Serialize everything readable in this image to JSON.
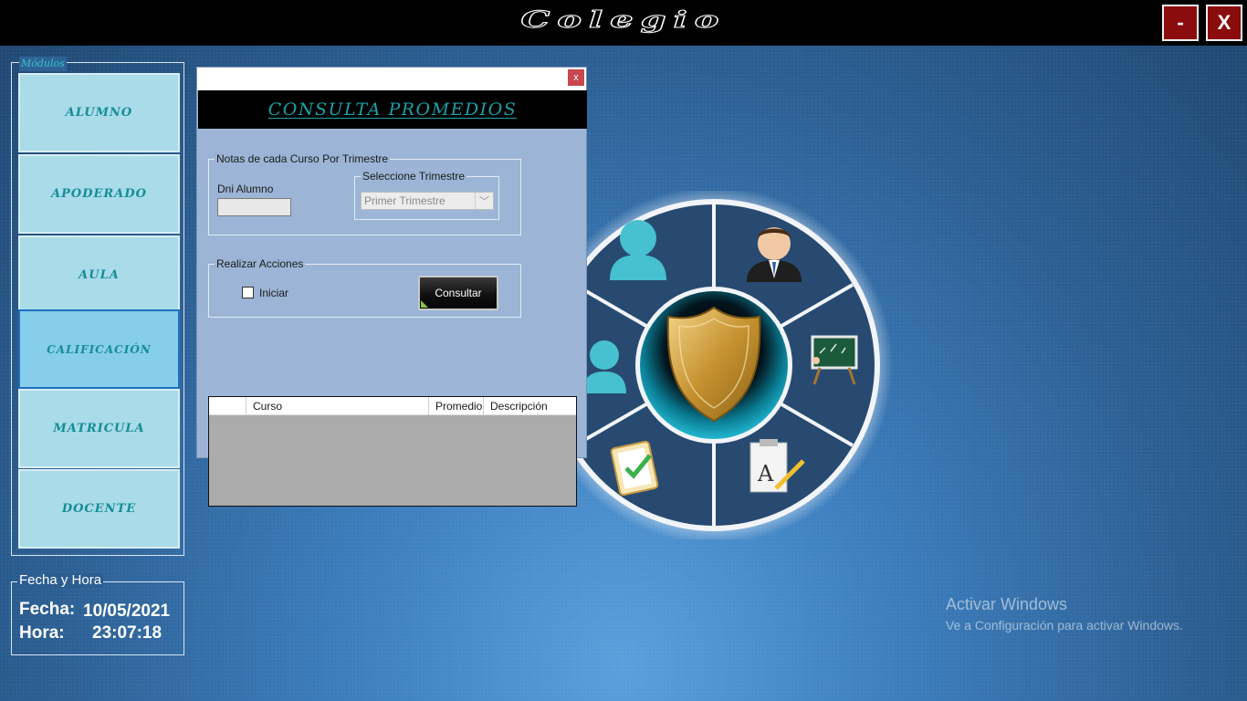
{
  "app": {
    "title": "Colegio",
    "minimize_label": "-",
    "close_label": "X"
  },
  "modules": {
    "legend": "Módulos",
    "items": [
      {
        "label": "ALUMNO"
      },
      {
        "label": "APODERADO"
      },
      {
        "label": "AULA"
      },
      {
        "label": "CALIFICACIÓN",
        "active": true
      },
      {
        "label": "MATRICULA"
      },
      {
        "label": "DOCENTE"
      }
    ]
  },
  "datetime": {
    "legend": "Fecha y Hora",
    "fecha_label": "Fecha:",
    "fecha_value": "10/05/2021",
    "hora_label": "Hora:",
    "hora_value": "23:07:18"
  },
  "dialog": {
    "close_label": "x",
    "heading": "CONSULTA PROMEDIOS",
    "notes_group": {
      "legend": "Notas de cada Curso Por Trimestre",
      "dni_label": "Dni Alumno",
      "dni_value": "",
      "trimestre_legend": "Seleccione Trimestre",
      "trimestre_value": "Primer Trimestre"
    },
    "actions_group": {
      "legend": "Realizar Acciones",
      "iniciar_label": "Iniciar",
      "iniciar_checked": false,
      "consultar_label": "Consultar"
    },
    "grid": {
      "columns": [
        "",
        "Curso",
        "Promedio",
        "Descripción"
      ],
      "rows": []
    }
  },
  "wheel": {
    "segments": [
      "person-icon",
      "businessman-icon",
      "chalkboard-icon",
      "document-pencil-icon",
      "clipboard-check-icon",
      "person-icon"
    ],
    "center": "shield-icon",
    "colors": {
      "ring": "#f3f6fa",
      "segment": "#2a4d73",
      "center": "#0d8fa6",
      "shield": "#c99a3a"
    }
  },
  "watermark": {
    "title": "Activar Windows",
    "subtitle": "Ve a Configuración para activar Windows."
  }
}
